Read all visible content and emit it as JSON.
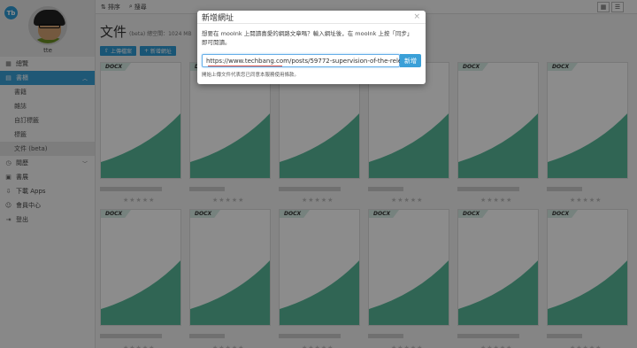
{
  "profile": {
    "app_logo_text": "Tb",
    "username": "tte"
  },
  "sidebar": {
    "items": [
      {
        "label": "總覽",
        "icon": "grid-icon"
      },
      {
        "label": "書櫃",
        "icon": "book-icon"
      },
      {
        "label": "書籍"
      },
      {
        "label": "雜誌"
      },
      {
        "label": "自訂標籤"
      },
      {
        "label": "標籤"
      },
      {
        "label": "文件 (beta)"
      },
      {
        "label": "閱歷",
        "icon": "history-icon"
      },
      {
        "label": "書展",
        "icon": "store-icon"
      },
      {
        "label": "下載 Apps",
        "icon": "download-icon"
      },
      {
        "label": "會員中心",
        "icon": "user-icon"
      },
      {
        "label": "登出",
        "icon": "logout-icon"
      }
    ]
  },
  "toolbar": {
    "sort_label": "排序",
    "search_label": "搜尋"
  },
  "main": {
    "title": "文件",
    "quota": "(beta) 總空間：1024 MB",
    "upload_button": "上傳檔案",
    "add_url_button": "新增網址",
    "doc_tag": "DOCX",
    "stars": "★★★★★"
  },
  "modal": {
    "title": "新增網址",
    "close": "×",
    "description": "想要在 mooInk 上閱讀喜愛的網路文章嗎？輸入網址後，在 mooInk 上按「同步」即可閱讀。",
    "url_value": "https://www.techbang.com/posts/59772-supervision-of-the-relea",
    "add_button": "新增",
    "note": "開始上傳文件代表您已同意本服務使用條款。"
  },
  "colors": {
    "accent": "#3aa0d8",
    "doc_green": "#58b89a"
  }
}
